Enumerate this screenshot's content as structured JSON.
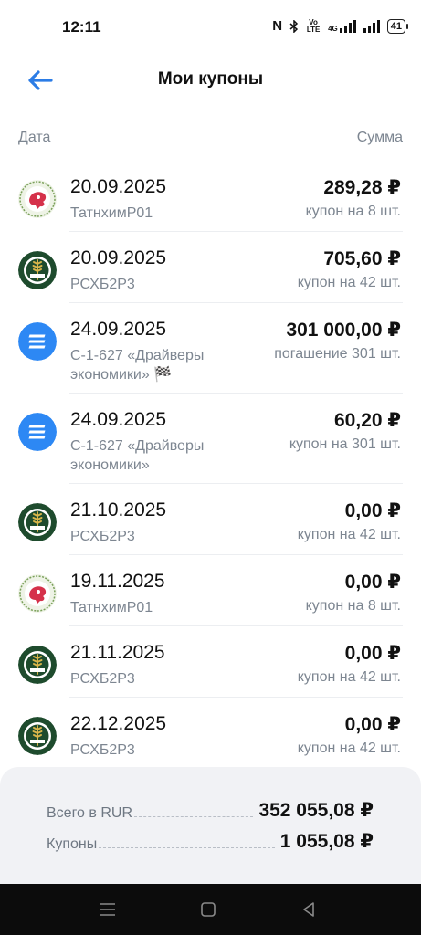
{
  "status_bar": {
    "time": "12:11",
    "nfc": "N",
    "volte": "Vo LTE",
    "network": "4G",
    "battery": "41"
  },
  "header": {
    "title": "Мои купоны"
  },
  "columns": {
    "date": "Дата",
    "sum": "Сумма"
  },
  "coupons": [
    {
      "date": "20.09.2025",
      "name": "ТатнхимР01",
      "amount": "289,28 ₽",
      "count": "купон на 8 шт.",
      "icon": "tatneft-logo-icon"
    },
    {
      "date": "20.09.2025",
      "name": "РСХБ2Р3",
      "amount": "705,60 ₽",
      "count": "купон на 42 шт.",
      "icon": "rshb-logo-icon"
    },
    {
      "date": "24.09.2025",
      "name": "С-1-627 «Драйверы экономики» 🏁",
      "amount": "301 000,00 ₽",
      "count": "погашение 301 шт.",
      "icon": "bond-logo-icon"
    },
    {
      "date": "24.09.2025",
      "name": "С-1-627 «Драйверы экономики»",
      "amount": "60,20 ₽",
      "count": "купон на 301 шт.",
      "icon": "bond-logo-icon"
    },
    {
      "date": "21.10.2025",
      "name": "РСХБ2Р3",
      "amount": "0,00 ₽",
      "count": "купон на 42 шт.",
      "icon": "rshb-logo-icon"
    },
    {
      "date": "19.11.2025",
      "name": "ТатнхимР01",
      "amount": "0,00 ₽",
      "count": "купон на 8 шт.",
      "icon": "tatneft-logo-icon"
    },
    {
      "date": "21.11.2025",
      "name": "РСХБ2Р3",
      "amount": "0,00 ₽",
      "count": "купон на 42 шт.",
      "icon": "rshb-logo-icon"
    },
    {
      "date": "22.12.2025",
      "name": "РСХБ2Р3",
      "amount": "0,00 ₽",
      "count": "купон на 42 шт.",
      "icon": "rshb-logo-icon"
    }
  ],
  "summary": {
    "total_label": "Всего в RUR",
    "total_value": "352 055,08 ₽",
    "coupons_label": "Купоны",
    "coupons_value": "1 055,08 ₽"
  },
  "colors": {
    "accent": "#2b7ce6",
    "bond_blue": "#2d88f4",
    "rshb_green": "#1e4b2d",
    "tatneft_red": "#d5314a"
  },
  "nav_icons": [
    "menu-icon",
    "home-icon",
    "back-triangle-icon"
  ]
}
